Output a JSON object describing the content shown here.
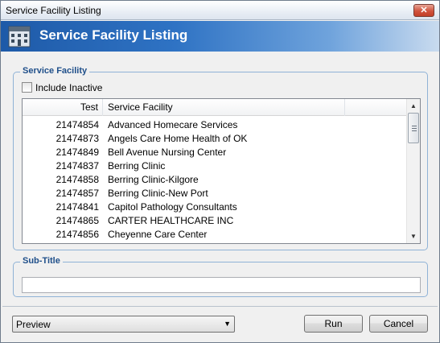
{
  "window": {
    "title": "Service Facility Listing",
    "close_symbol": "✕"
  },
  "banner": {
    "title": "Service Facility Listing",
    "icon": "building-icon"
  },
  "facility_group": {
    "legend": "Service Facility",
    "include_inactive_label": "Include Inactive",
    "include_inactive_checked": false,
    "columns": [
      "Test",
      "Service Facility"
    ],
    "rows": [
      {
        "test": "21474854",
        "facility": "Advanced Homecare Services"
      },
      {
        "test": "21474873",
        "facility": "Angels Care Home Health of OK"
      },
      {
        "test": "21474849",
        "facility": "Bell Avenue Nursing Center"
      },
      {
        "test": "21474837",
        "facility": "Berring Clinic"
      },
      {
        "test": "21474858",
        "facility": "Berring Clinic-Kilgore"
      },
      {
        "test": "21474857",
        "facility": "Berring Clinic-New Port"
      },
      {
        "test": "21474841",
        "facility": "Capitol Pathology Consultants"
      },
      {
        "test": "21474865",
        "facility": "CARTER HEALTHCARE INC"
      },
      {
        "test": "21474856",
        "facility": "Cheyenne Care Center"
      }
    ]
  },
  "subtitle_group": {
    "legend": "Sub-Title",
    "value": ""
  },
  "footer": {
    "output_mode": "Preview",
    "run_label": "Run",
    "cancel_label": "Cancel"
  },
  "colors": {
    "banner_start": "#1e5aa8",
    "group_legend": "#1f4f8a"
  }
}
